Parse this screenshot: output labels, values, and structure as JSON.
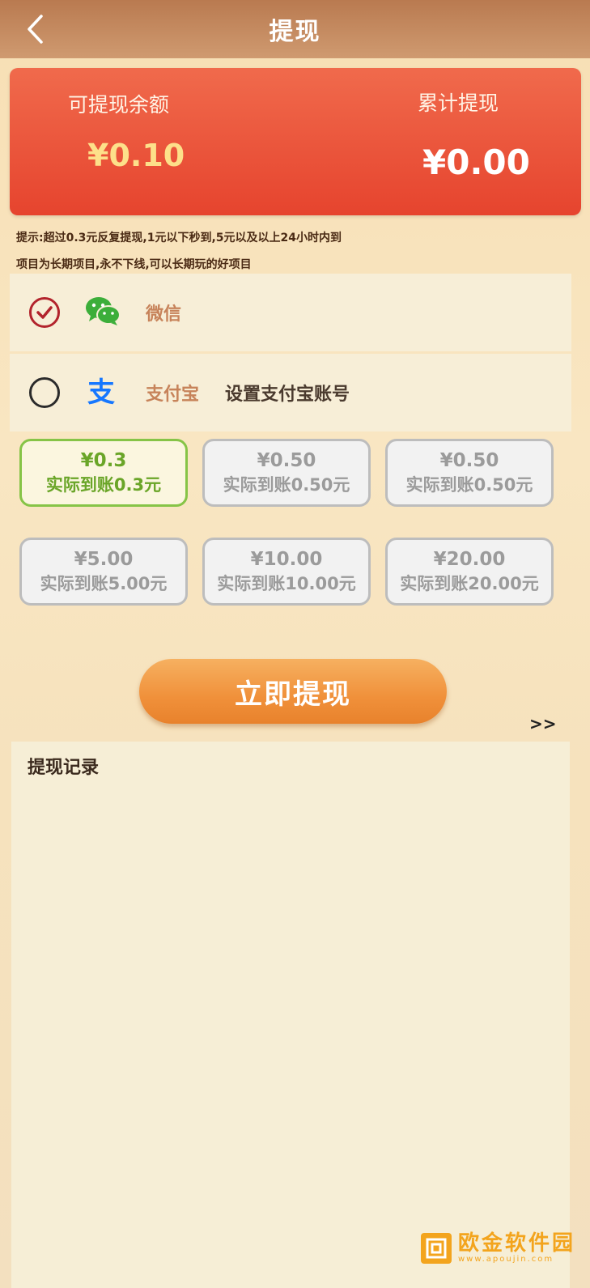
{
  "header": {
    "title": "提现"
  },
  "balance": {
    "available_label": "可提现余额",
    "available_value": "¥0.10",
    "total_label": "累计提现",
    "total_value": "¥0.00"
  },
  "tips": [
    "提示:超过0.3元反复提现,1元以下秒到,5元以及以上24小时内到",
    "项目为长期项目,永不下线,可以长期玩的好项目"
  ],
  "payment_methods": {
    "wechat": {
      "name": "微信",
      "selected": true,
      "icon": "wechat-icon"
    },
    "alipay": {
      "name": "支付宝",
      "action": "设置支付宝账号",
      "selected": false,
      "icon": "alipay-icon"
    }
  },
  "amounts": [
    {
      "value": "¥0.3",
      "sub": "实际到账0.3元",
      "selected": true
    },
    {
      "value": "¥0.50",
      "sub": "实际到账0.50元",
      "selected": false
    },
    {
      "value": "¥0.50",
      "sub": "实际到账0.50元",
      "selected": false
    },
    {
      "value": "¥5.00",
      "sub": "实际到账5.00元",
      "selected": false
    },
    {
      "value": "¥10.00",
      "sub": "实际到账10.00元",
      "selected": false
    },
    {
      "value": "¥20.00",
      "sub": "实际到账20.00元",
      "selected": false
    }
  ],
  "withdraw_button": "立即提现",
  "more_link": ">>",
  "records": {
    "title": "提现记录"
  },
  "watermark": {
    "name": "欧金软件园",
    "url": "www.apoujin.com"
  },
  "colors": {
    "header": "#c48b60",
    "card": "#eb5539",
    "available_value": "#fde08a",
    "selected_border": "#86c447",
    "button": "#f0903a"
  }
}
